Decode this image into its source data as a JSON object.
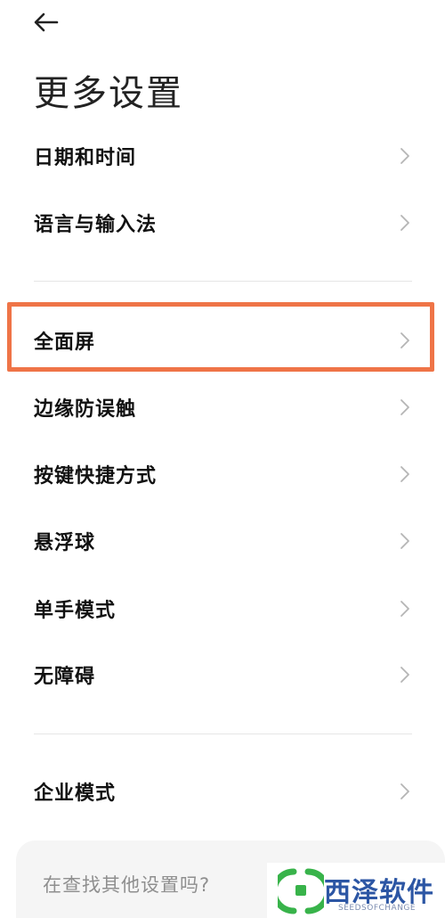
{
  "header": {
    "back_icon": "arrow-left-icon",
    "title": "更多设置"
  },
  "section1": {
    "items": [
      {
        "label": "日期和时间"
      },
      {
        "label": "语言与输入法"
      }
    ]
  },
  "section2": {
    "items": [
      {
        "label": "全面屏"
      },
      {
        "label": "边缘防误触"
      },
      {
        "label": "按键快捷方式"
      },
      {
        "label": "悬浮球"
      },
      {
        "label": "单手模式"
      },
      {
        "label": "无障碍"
      }
    ]
  },
  "section3": {
    "items": [
      {
        "label": "企业模式"
      }
    ]
  },
  "search_card": {
    "hint": "在查找其他设置吗?"
  },
  "watermark": {
    "text": "西泽软件",
    "sub": "SEEDSOFCHANGE"
  },
  "colors": {
    "highlight": "#ef7447",
    "chevron": "#b5b5b5",
    "watermark_blue": "#2c56a4",
    "watermark_green": "#38b34a"
  }
}
